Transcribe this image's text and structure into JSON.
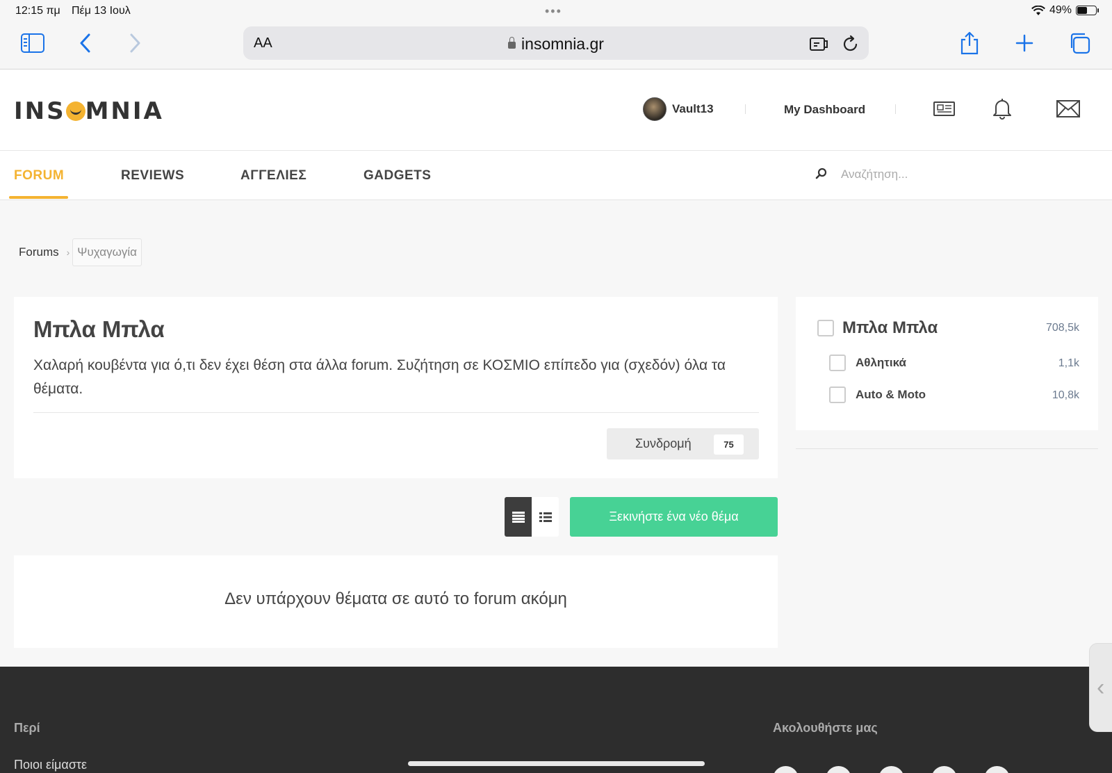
{
  "status_bar": {
    "time": "12:15 πμ",
    "date": "Πέμ 13 Ιουλ",
    "battery": "49%",
    "battery_level": 0.49
  },
  "browser": {
    "aa_label": "AA",
    "url": "insomnia.gr"
  },
  "site": {
    "logo_text_a": "INS",
    "logo_text_b": "MNIA",
    "username": "Vault13",
    "dashboard_label": "My Dashboard"
  },
  "nav": {
    "items": [
      {
        "label": "FORUM",
        "active": true
      },
      {
        "label": "REVIEWS"
      },
      {
        "label": "ΑΓΓΕΛΙΕΣ"
      },
      {
        "label": "GADGETS"
      }
    ],
    "search_placeholder": "Αναζήτηση..."
  },
  "breadcrumb": [
    "Forums",
    "Ψυχαγωγία"
  ],
  "forum": {
    "title": "Μπλα Μπλα",
    "description": "Χαλαρή κουβέντα για ό,τι δεν έχει θέση στα άλλα forum. Συζήτηση σε ΚΟΣΜΙΟ επίπεδο για (σχεδόν) όλα τα θέματα.",
    "follow_label": "Συνδρομή",
    "follow_count": "75",
    "new_topic_label": "Ξεκινήστε ένα νέο θέμα",
    "empty_message": "Δεν υπάρχουν θέματα σε αυτό το forum ακόμη"
  },
  "sidebar": {
    "items": [
      {
        "name": "Μπλα Μπλα",
        "count": "708,5k"
      },
      {
        "name": "Αθλητικά",
        "count": "1,1k"
      },
      {
        "name": "Auto & Moto",
        "count": "10,8k"
      }
    ]
  },
  "footer": {
    "about_heading": "Περί",
    "about_link": "Ποιοι είμαστε",
    "follow_heading": "Ακολουθήστε μας"
  },
  "colors": {
    "accent": "#f4b331",
    "primary_button": "#47d295",
    "ios_blue": "#1a73e8",
    "footer_bg": "#2d2d2d"
  }
}
